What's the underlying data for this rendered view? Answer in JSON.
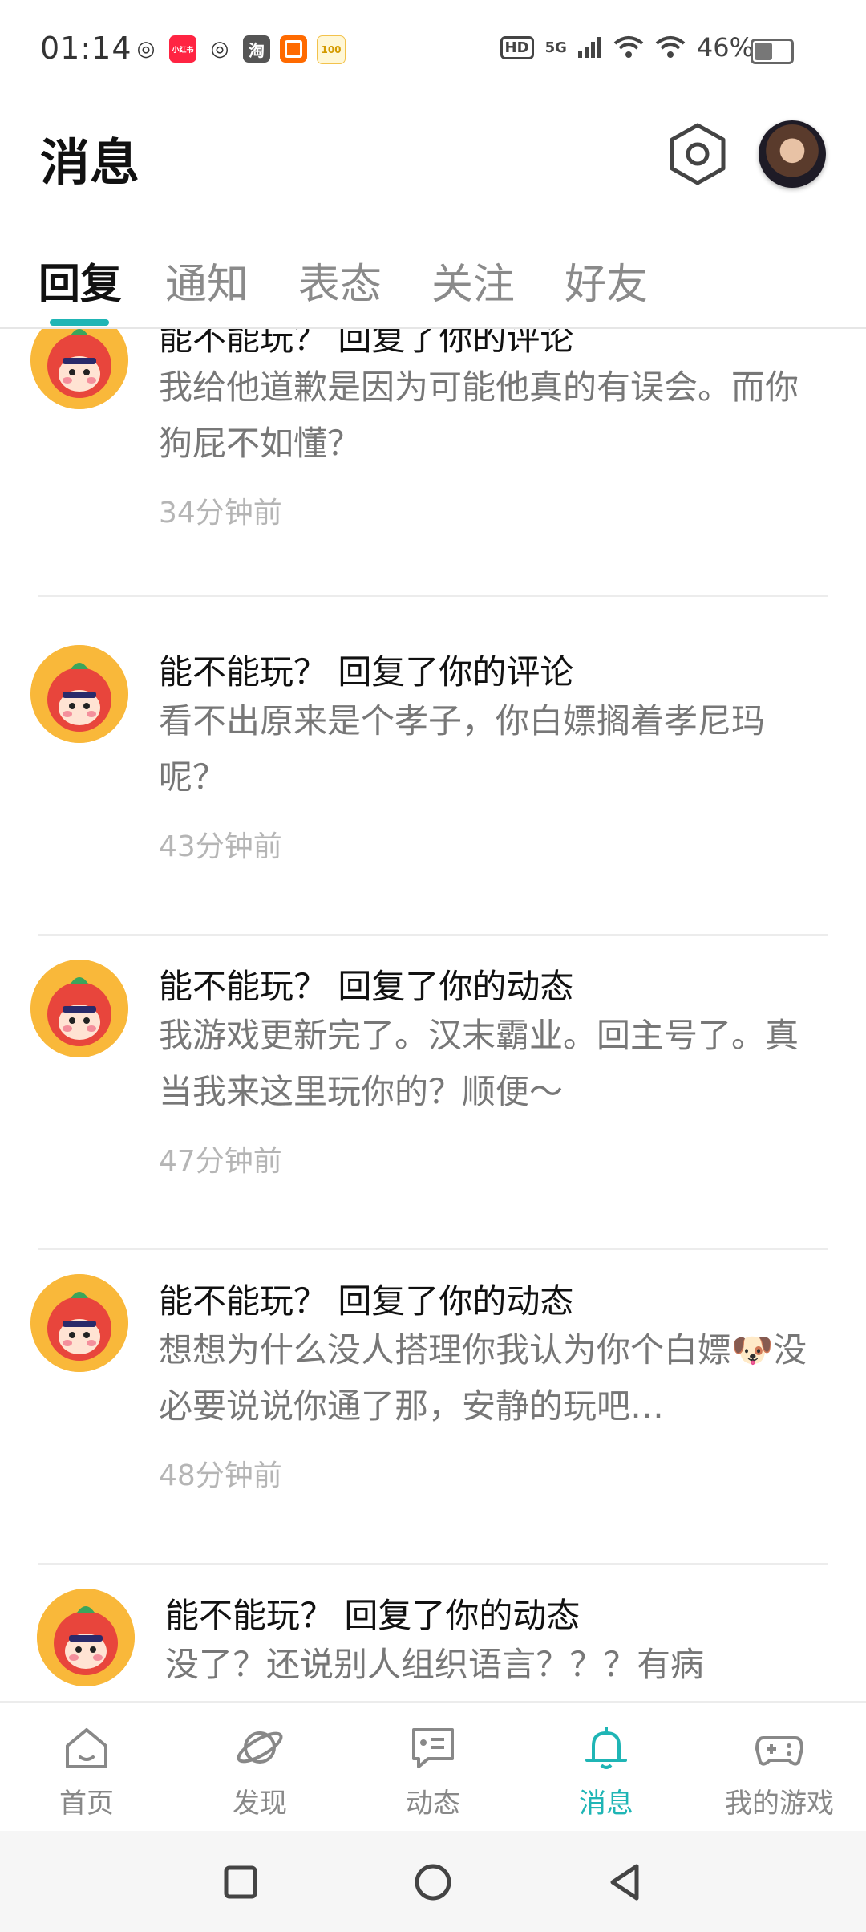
{
  "status_bar": {
    "time": "01:14",
    "app_icons": [
      {
        "icon": "weibo-icon",
        "text": "",
        "color": "#333333"
      },
      {
        "icon": "xiaohongshu-icon",
        "text": "小红书",
        "color": "#ff2442"
      },
      {
        "icon": "weibo-icon",
        "text": "",
        "color": "#333333"
      },
      {
        "icon": "taobao-icon",
        "text": "淘",
        "color": "#555555"
      },
      {
        "icon": "app-icon",
        "text": "",
        "color": "#ff6a00"
      },
      {
        "icon": "app-100-icon",
        "text": "100",
        "color": "#f3c24b"
      }
    ],
    "hd": "HD",
    "network": "5G",
    "battery_text": "46%",
    "battery_level": 0.46
  },
  "header": {
    "title": "消息"
  },
  "tabs": [
    {
      "label": "回复",
      "active": true
    },
    {
      "label": "通知",
      "active": false
    },
    {
      "label": "表态",
      "active": false
    },
    {
      "label": "关注",
      "active": false
    },
    {
      "label": "好友",
      "active": false
    }
  ],
  "messages": [
    {
      "title": "能不能玩？ 回复了你的评论",
      "body": "我给他道歉是因为可能他真的有误会。而你狗屁不如懂？",
      "time": "34分钟前"
    },
    {
      "title": "能不能玩？ 回复了你的评论",
      "body": "看不出原来是个孝子，你白嫖搁着孝尼玛呢？",
      "time": "43分钟前"
    },
    {
      "title": "能不能玩？ 回复了你的动态",
      "body": "我游戏更新完了。汉末霸业。回主号了。真当我来这里玩你的？顺便～",
      "time": "47分钟前"
    },
    {
      "title": "能不能玩？ 回复了你的动态",
      "body": "想想为什么没人搭理你我认为你个白嫖🐶没必要说说你通了那，安静的玩吧…",
      "time": "48分钟前"
    },
    {
      "title": "能不能玩？ 回复了你的动态",
      "body": "没了？还说别人组织语言？？？有病",
      "time": ""
    }
  ],
  "bottom_nav": [
    {
      "label": "首页",
      "icon": "home-icon",
      "active": false
    },
    {
      "label": "发现",
      "icon": "discover-planet-icon",
      "active": false
    },
    {
      "label": "动态",
      "icon": "feed-chat-icon",
      "active": false
    },
    {
      "label": "消息",
      "icon": "bell-icon",
      "active": true
    },
    {
      "label": "我的游戏",
      "icon": "gamepad-icon",
      "active": false
    }
  ],
  "colors": {
    "accent": "#1fb5b5",
    "text_primary": "#111111",
    "text_secondary": "#777777",
    "text_time": "#b5b5b5"
  }
}
